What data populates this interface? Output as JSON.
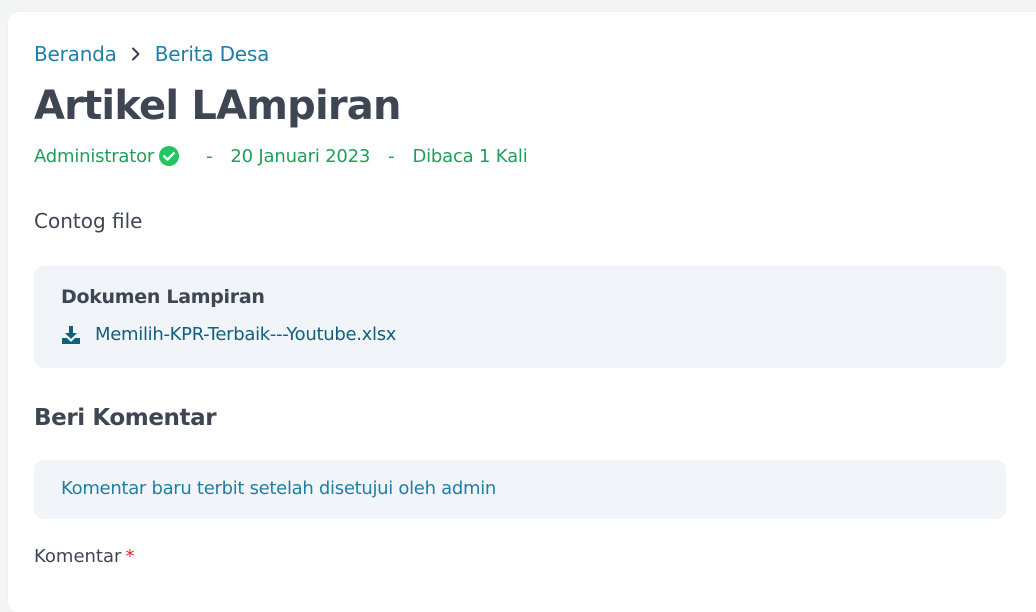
{
  "breadcrumb": {
    "home": "Beranda",
    "current": "Berita Desa"
  },
  "article": {
    "title": "Artikel LAmpiran",
    "author": "Administrator",
    "separator": "-",
    "date": "20 Januari 2023",
    "read_count": "Dibaca 1 Kali",
    "intro": "Contog file"
  },
  "attachments": {
    "heading": "Dokumen Lampiran",
    "files": [
      {
        "name": "Memilih-KPR-Terbaik---Youtube.xlsx",
        "icon": "download-icon"
      }
    ]
  },
  "comments": {
    "heading": "Beri Komentar",
    "notice": "Komentar baru terbit setelah disetujui oleh admin",
    "field_label": "Komentar",
    "required_mark": "*"
  },
  "colors": {
    "link": "#1f7fa6",
    "meta": "#1f9f5a",
    "verified": "#22c55e",
    "title": "#3f4653",
    "box_bg": "#f1f4f8",
    "required": "#dc2626"
  }
}
